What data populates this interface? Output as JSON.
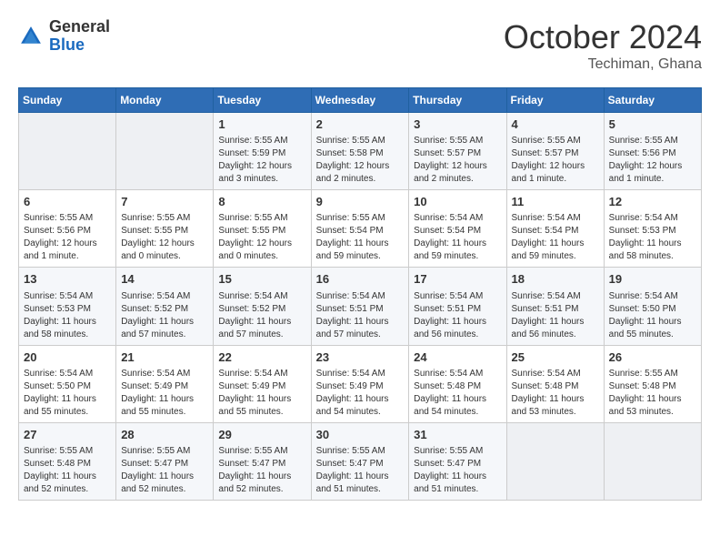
{
  "header": {
    "logo_general": "General",
    "logo_blue": "Blue",
    "month": "October 2024",
    "location": "Techiman, Ghana"
  },
  "days_of_week": [
    "Sunday",
    "Monday",
    "Tuesday",
    "Wednesday",
    "Thursday",
    "Friday",
    "Saturday"
  ],
  "weeks": [
    [
      {
        "day": "",
        "info": ""
      },
      {
        "day": "",
        "info": ""
      },
      {
        "day": "1",
        "info": "Sunrise: 5:55 AM\nSunset: 5:59 PM\nDaylight: 12 hours and 3 minutes."
      },
      {
        "day": "2",
        "info": "Sunrise: 5:55 AM\nSunset: 5:58 PM\nDaylight: 12 hours and 2 minutes."
      },
      {
        "day": "3",
        "info": "Sunrise: 5:55 AM\nSunset: 5:57 PM\nDaylight: 12 hours and 2 minutes."
      },
      {
        "day": "4",
        "info": "Sunrise: 5:55 AM\nSunset: 5:57 PM\nDaylight: 12 hours and 1 minute."
      },
      {
        "day": "5",
        "info": "Sunrise: 5:55 AM\nSunset: 5:56 PM\nDaylight: 12 hours and 1 minute."
      }
    ],
    [
      {
        "day": "6",
        "info": "Sunrise: 5:55 AM\nSunset: 5:56 PM\nDaylight: 12 hours and 1 minute."
      },
      {
        "day": "7",
        "info": "Sunrise: 5:55 AM\nSunset: 5:55 PM\nDaylight: 12 hours and 0 minutes."
      },
      {
        "day": "8",
        "info": "Sunrise: 5:55 AM\nSunset: 5:55 PM\nDaylight: 12 hours and 0 minutes."
      },
      {
        "day": "9",
        "info": "Sunrise: 5:55 AM\nSunset: 5:54 PM\nDaylight: 11 hours and 59 minutes."
      },
      {
        "day": "10",
        "info": "Sunrise: 5:54 AM\nSunset: 5:54 PM\nDaylight: 11 hours and 59 minutes."
      },
      {
        "day": "11",
        "info": "Sunrise: 5:54 AM\nSunset: 5:54 PM\nDaylight: 11 hours and 59 minutes."
      },
      {
        "day": "12",
        "info": "Sunrise: 5:54 AM\nSunset: 5:53 PM\nDaylight: 11 hours and 58 minutes."
      }
    ],
    [
      {
        "day": "13",
        "info": "Sunrise: 5:54 AM\nSunset: 5:53 PM\nDaylight: 11 hours and 58 minutes."
      },
      {
        "day": "14",
        "info": "Sunrise: 5:54 AM\nSunset: 5:52 PM\nDaylight: 11 hours and 57 minutes."
      },
      {
        "day": "15",
        "info": "Sunrise: 5:54 AM\nSunset: 5:52 PM\nDaylight: 11 hours and 57 minutes."
      },
      {
        "day": "16",
        "info": "Sunrise: 5:54 AM\nSunset: 5:51 PM\nDaylight: 11 hours and 57 minutes."
      },
      {
        "day": "17",
        "info": "Sunrise: 5:54 AM\nSunset: 5:51 PM\nDaylight: 11 hours and 56 minutes."
      },
      {
        "day": "18",
        "info": "Sunrise: 5:54 AM\nSunset: 5:51 PM\nDaylight: 11 hours and 56 minutes."
      },
      {
        "day": "19",
        "info": "Sunrise: 5:54 AM\nSunset: 5:50 PM\nDaylight: 11 hours and 55 minutes."
      }
    ],
    [
      {
        "day": "20",
        "info": "Sunrise: 5:54 AM\nSunset: 5:50 PM\nDaylight: 11 hours and 55 minutes."
      },
      {
        "day": "21",
        "info": "Sunrise: 5:54 AM\nSunset: 5:49 PM\nDaylight: 11 hours and 55 minutes."
      },
      {
        "day": "22",
        "info": "Sunrise: 5:54 AM\nSunset: 5:49 PM\nDaylight: 11 hours and 55 minutes."
      },
      {
        "day": "23",
        "info": "Sunrise: 5:54 AM\nSunset: 5:49 PM\nDaylight: 11 hours and 54 minutes."
      },
      {
        "day": "24",
        "info": "Sunrise: 5:54 AM\nSunset: 5:48 PM\nDaylight: 11 hours and 54 minutes."
      },
      {
        "day": "25",
        "info": "Sunrise: 5:54 AM\nSunset: 5:48 PM\nDaylight: 11 hours and 53 minutes."
      },
      {
        "day": "26",
        "info": "Sunrise: 5:55 AM\nSunset: 5:48 PM\nDaylight: 11 hours and 53 minutes."
      }
    ],
    [
      {
        "day": "27",
        "info": "Sunrise: 5:55 AM\nSunset: 5:48 PM\nDaylight: 11 hours and 52 minutes."
      },
      {
        "day": "28",
        "info": "Sunrise: 5:55 AM\nSunset: 5:47 PM\nDaylight: 11 hours and 52 minutes."
      },
      {
        "day": "29",
        "info": "Sunrise: 5:55 AM\nSunset: 5:47 PM\nDaylight: 11 hours and 52 minutes."
      },
      {
        "day": "30",
        "info": "Sunrise: 5:55 AM\nSunset: 5:47 PM\nDaylight: 11 hours and 51 minutes."
      },
      {
        "day": "31",
        "info": "Sunrise: 5:55 AM\nSunset: 5:47 PM\nDaylight: 11 hours and 51 minutes."
      },
      {
        "day": "",
        "info": ""
      },
      {
        "day": "",
        "info": ""
      }
    ]
  ]
}
